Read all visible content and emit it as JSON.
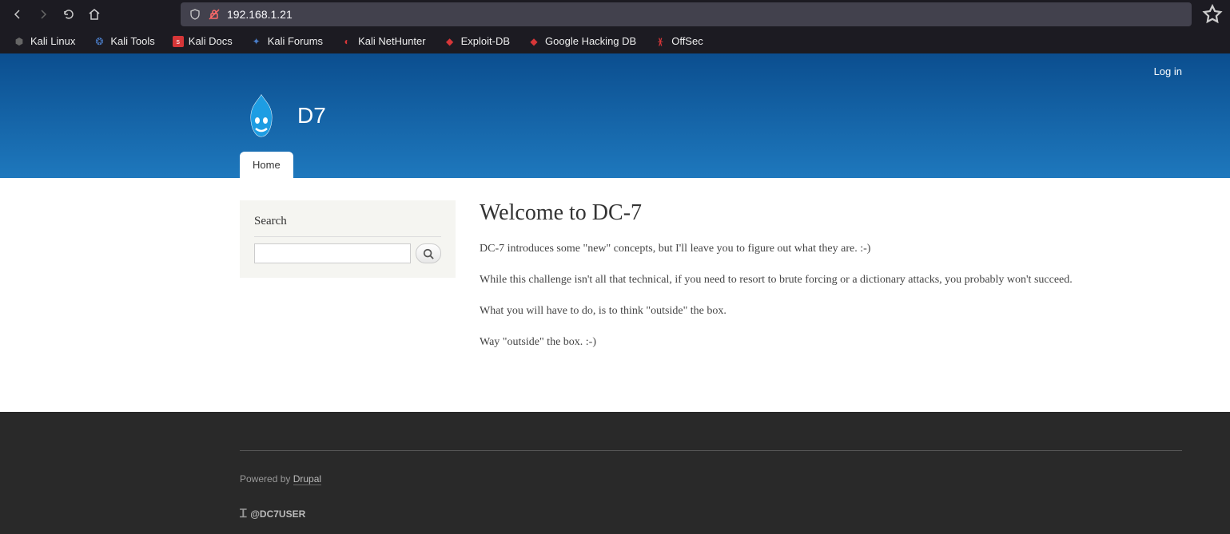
{
  "browser": {
    "url": "192.168.1.21"
  },
  "bookmarks": [
    {
      "label": "Kali Linux",
      "icon_color": "#333"
    },
    {
      "label": "Kali Tools",
      "icon_color": "#4a7dc9"
    },
    {
      "label": "Kali Docs",
      "icon_color": "#d63638"
    },
    {
      "label": "Kali Forums",
      "icon_color": "#4a7dc9"
    },
    {
      "label": "Kali NetHunter",
      "icon_color": "#d63638"
    },
    {
      "label": "Exploit-DB",
      "icon_color": "#d63638"
    },
    {
      "label": "Google Hacking DB",
      "icon_color": "#d63638"
    },
    {
      "label": "OffSec",
      "icon_color": "#d63638"
    }
  ],
  "user_menu": {
    "login_label": "Log in"
  },
  "site": {
    "name": "D7"
  },
  "tabs": {
    "home": "Home"
  },
  "search": {
    "heading": "Search",
    "value": ""
  },
  "article": {
    "title": "Welcome to DC-7",
    "p1": "DC-7 introduces some \"new\" concepts, but I'll leave you to figure out what they are.  :-)",
    "p2": "While this challenge isn't all that technical, if you need to resort to brute forcing or a dictionary attacks, you probably won't succeed.",
    "p3": "What you will have to do, is to think \"outside\" the box.",
    "p4": "Way \"outside\" the box.  :-)"
  },
  "footer": {
    "powered_by": "Powered by ",
    "drupal_link": "Drupal",
    "user": "@DC7USER"
  }
}
